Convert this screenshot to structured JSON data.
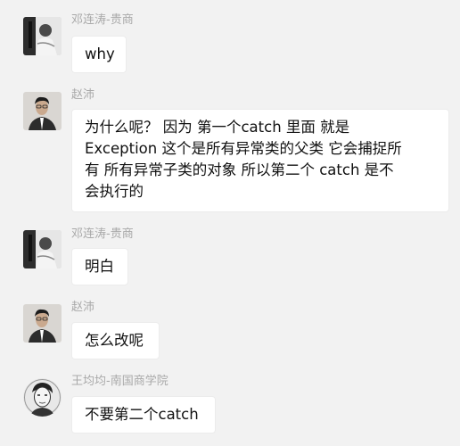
{
  "messages": [
    {
      "sender": "邓连涛-贵商",
      "text": "why",
      "avatar": "avatar-photo-bw"
    },
    {
      "sender": "赵沛",
      "text": "为什么呢？   因为  第一个catch 里面 就是\nException  这个是所有异常类的父类   它会捕捉所\n有 所有异常子类的对象   所以第二个 catch 是不\n会执行的",
      "avatar": "avatar-photo-portrait"
    },
    {
      "sender": "邓连涛-贵商",
      "text": "明白",
      "avatar": "avatar-photo-bw"
    },
    {
      "sender": "赵沛",
      "text": "怎么改呢",
      "avatar": "avatar-photo-portrait"
    },
    {
      "sender": "王均均-南国商学院",
      "text": "不要第二个catch",
      "avatar": "avatar-sketch-portrait"
    }
  ],
  "colors": {
    "background": "#f2f2f2",
    "bubble": "#ffffff",
    "sender_name": "#a9a9a9",
    "text": "#111111"
  }
}
